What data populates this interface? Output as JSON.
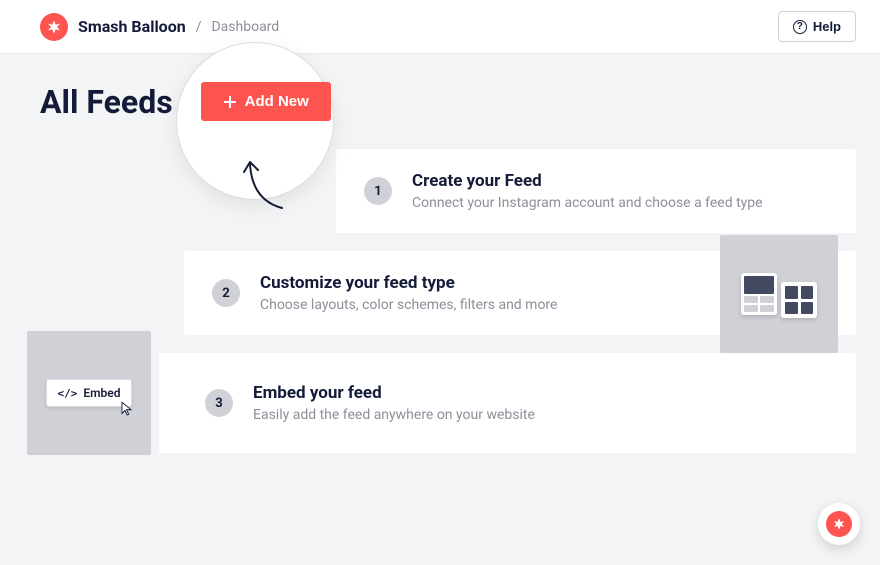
{
  "header": {
    "brand": "Smash Balloon",
    "breadcrumb": "Dashboard",
    "help_label": "Help"
  },
  "page": {
    "title": "All Feeds",
    "add_new_label": "Add New"
  },
  "steps": [
    {
      "num": "1",
      "title": "Create your Feed",
      "desc": "Connect your Instagram account and choose a feed type"
    },
    {
      "num": "2",
      "title": "Customize your feed type",
      "desc": "Choose layouts, color schemes, filters and more"
    },
    {
      "num": "3",
      "title": "Embed your feed",
      "desc": "Easily add the feed anywhere on your website"
    }
  ],
  "embed_chip": {
    "label": "Embed"
  }
}
